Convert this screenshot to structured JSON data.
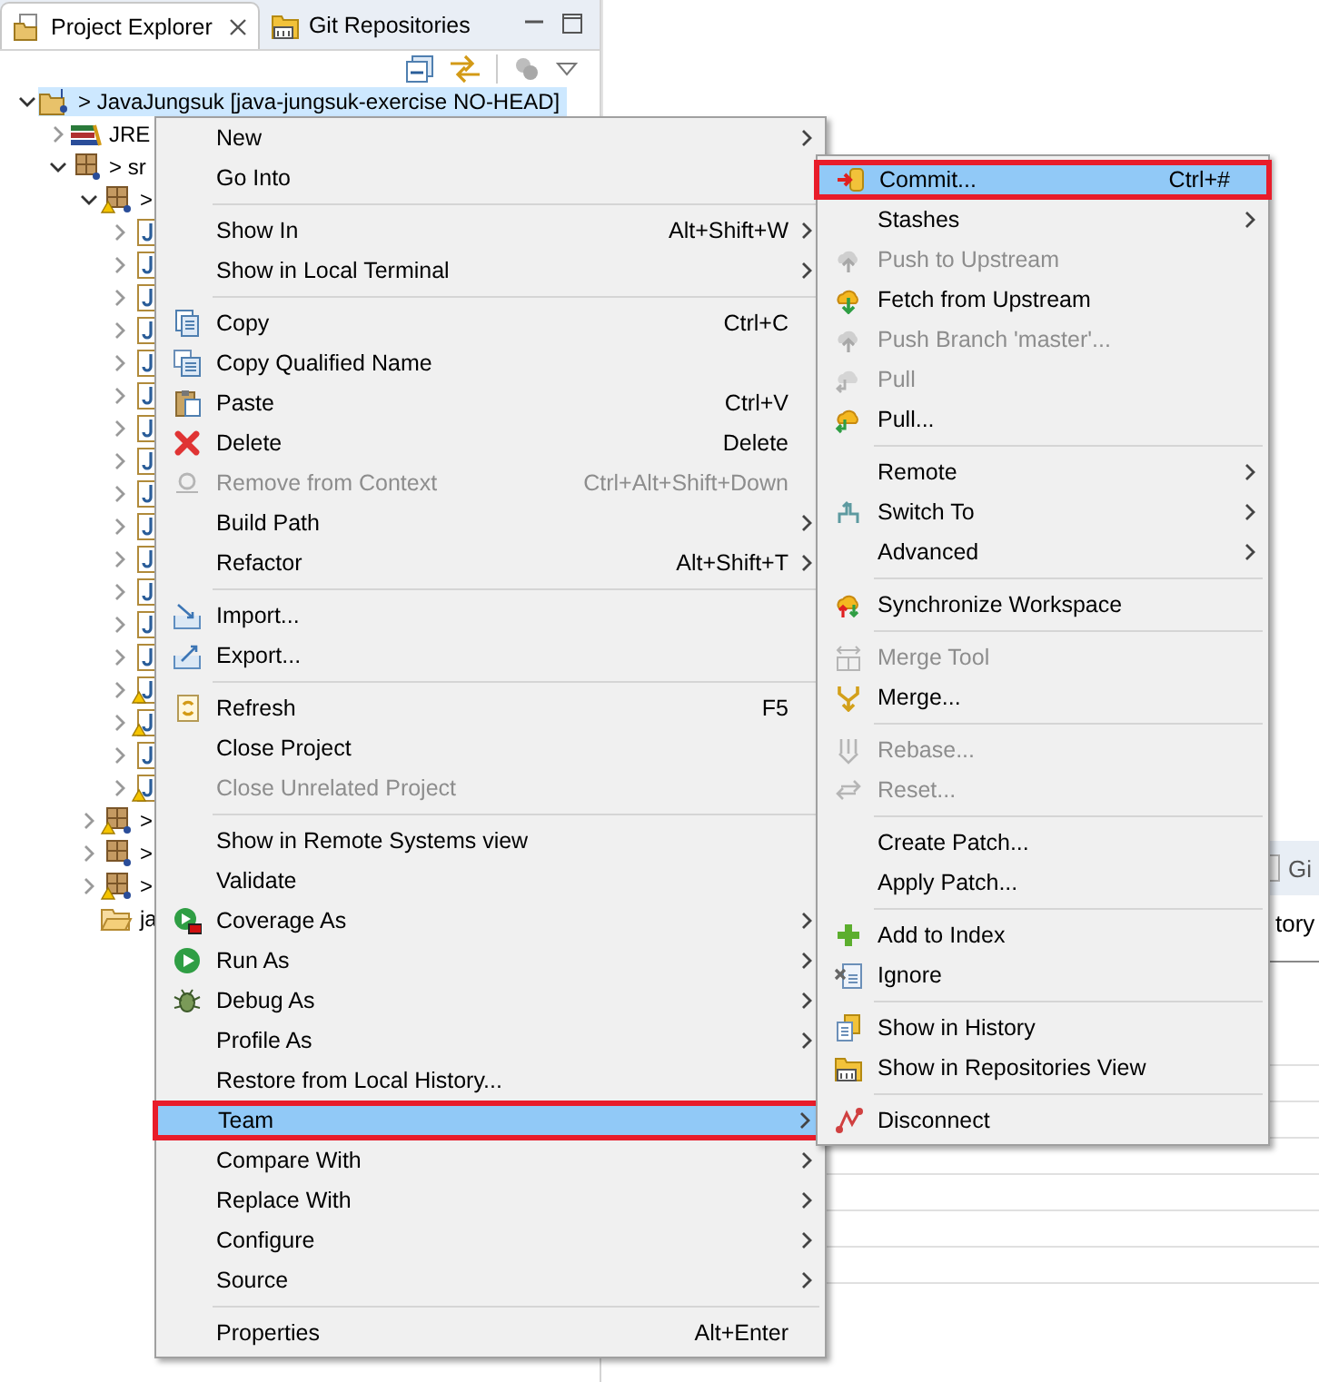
{
  "explorer": {
    "tabs": [
      {
        "label": "Project Explorer",
        "selected": true,
        "closable": true
      },
      {
        "label": "Git Repositories",
        "selected": false,
        "closable": false
      }
    ],
    "tree": [
      {
        "kind": "project",
        "label": "> JavaJungsuk [java-jungsuk-exercise NO-HEAD]",
        "selected": true,
        "expanded": true,
        "children": [
          {
            "kind": "library",
            "label": "JRE",
            "selected": false,
            "expanded": false
          },
          {
            "kind": "source",
            "label": "> sr",
            "selected": false,
            "expanded": true,
            "children": [
              {
                "kind": "package",
                "label": ">",
                "selected": false,
                "expanded": true,
                "warning": true,
                "children": [
                  {
                    "kind": "file",
                    "selected": false,
                    "expanded": false,
                    "warning": false
                  },
                  {
                    "kind": "file",
                    "selected": false,
                    "expanded": false,
                    "warning": false
                  },
                  {
                    "kind": "file",
                    "selected": false,
                    "expanded": false,
                    "warning": false
                  },
                  {
                    "kind": "file",
                    "selected": false,
                    "expanded": false,
                    "warning": false
                  },
                  {
                    "kind": "file",
                    "selected": false,
                    "expanded": false,
                    "warning": false
                  },
                  {
                    "kind": "file",
                    "selected": false,
                    "expanded": false,
                    "warning": false
                  },
                  {
                    "kind": "file",
                    "selected": false,
                    "expanded": false,
                    "warning": false
                  },
                  {
                    "kind": "file",
                    "selected": false,
                    "expanded": false,
                    "warning": false
                  },
                  {
                    "kind": "file",
                    "selected": false,
                    "expanded": false,
                    "warning": false
                  },
                  {
                    "kind": "file",
                    "selected": false,
                    "expanded": false,
                    "warning": false
                  },
                  {
                    "kind": "file",
                    "selected": false,
                    "expanded": false,
                    "warning": false
                  },
                  {
                    "kind": "file",
                    "selected": false,
                    "expanded": false,
                    "warning": false
                  },
                  {
                    "kind": "file",
                    "selected": false,
                    "expanded": false,
                    "warning": false
                  },
                  {
                    "kind": "file",
                    "selected": false,
                    "expanded": false,
                    "warning": false
                  },
                  {
                    "kind": "file",
                    "selected": false,
                    "expanded": false,
                    "warning": true
                  },
                  {
                    "kind": "file",
                    "selected": false,
                    "expanded": false,
                    "warning": true
                  },
                  {
                    "kind": "file",
                    "selected": false,
                    "expanded": false,
                    "warning": false
                  },
                  {
                    "kind": "file",
                    "selected": false,
                    "expanded": false,
                    "warning": true
                  }
                ]
              },
              {
                "kind": "package",
                "label": ">",
                "selected": false,
                "expanded": false,
                "warning": true
              },
              {
                "kind": "package",
                "label": ">",
                "selected": false,
                "expanded": false,
                "warning": false
              },
              {
                "kind": "package",
                "label": ">",
                "selected": false,
                "expanded": false,
                "warning": true
              },
              {
                "kind": "folder",
                "label": "ja",
                "selected": false
              }
            ]
          }
        ]
      }
    ]
  },
  "context_menu": {
    "items": [
      {
        "kind": "item",
        "label": "New",
        "submenu": true,
        "disabled": false,
        "selected": false,
        "icon": false
      },
      {
        "kind": "item",
        "label": "Go Into",
        "submenu": false,
        "disabled": false,
        "selected": false,
        "icon": false
      },
      {
        "kind": "separator"
      },
      {
        "kind": "item",
        "label": "Show In",
        "shortcut": "Alt+Shift+W",
        "submenu": true,
        "disabled": false,
        "selected": false,
        "icon": false
      },
      {
        "kind": "item",
        "label": "Show in Local Terminal",
        "submenu": true,
        "disabled": false,
        "selected": false,
        "icon": false
      },
      {
        "kind": "separator"
      },
      {
        "kind": "item",
        "label": "Copy",
        "shortcut": "Ctrl+C",
        "submenu": false,
        "disabled": false,
        "selected": false,
        "icon": true
      },
      {
        "kind": "item",
        "label": "Copy Qualified Name",
        "submenu": false,
        "disabled": false,
        "selected": false,
        "icon": true
      },
      {
        "kind": "item",
        "label": "Paste",
        "shortcut": "Ctrl+V",
        "submenu": false,
        "disabled": false,
        "selected": false,
        "icon": true
      },
      {
        "kind": "item",
        "label": "Delete",
        "shortcut": "Delete",
        "submenu": false,
        "disabled": false,
        "selected": false,
        "icon": true
      },
      {
        "kind": "item",
        "label": "Remove from Context",
        "shortcut": "Ctrl+Alt+Shift+Down",
        "submenu": false,
        "disabled": true,
        "selected": false,
        "icon": true
      },
      {
        "kind": "item",
        "label": "Build Path",
        "submenu": true,
        "disabled": false,
        "selected": false,
        "icon": false
      },
      {
        "kind": "item",
        "label": "Refactor",
        "shortcut": "Alt+Shift+T",
        "submenu": true,
        "disabled": false,
        "selected": false,
        "icon": false
      },
      {
        "kind": "separator"
      },
      {
        "kind": "item",
        "label": "Import...",
        "submenu": false,
        "disabled": false,
        "selected": false,
        "icon": true
      },
      {
        "kind": "item",
        "label": "Export...",
        "submenu": false,
        "disabled": false,
        "selected": false,
        "icon": true
      },
      {
        "kind": "separator"
      },
      {
        "kind": "item",
        "label": "Refresh",
        "shortcut": "F5",
        "submenu": false,
        "disabled": false,
        "selected": false,
        "icon": true
      },
      {
        "kind": "item",
        "label": "Close Project",
        "submenu": false,
        "disabled": false,
        "selected": false,
        "icon": false
      },
      {
        "kind": "item",
        "label": "Close Unrelated Project",
        "submenu": false,
        "disabled": true,
        "selected": false,
        "icon": false
      },
      {
        "kind": "separator"
      },
      {
        "kind": "item",
        "label": "Show in Remote Systems view",
        "submenu": false,
        "disabled": false,
        "selected": false,
        "icon": false
      },
      {
        "kind": "item",
        "label": "Validate",
        "submenu": false,
        "disabled": false,
        "selected": false,
        "icon": false
      },
      {
        "kind": "item",
        "label": "Coverage As",
        "submenu": true,
        "disabled": false,
        "selected": false,
        "icon": true
      },
      {
        "kind": "item",
        "label": "Run As",
        "submenu": true,
        "disabled": false,
        "selected": false,
        "icon": true
      },
      {
        "kind": "item",
        "label": "Debug As",
        "submenu": true,
        "disabled": false,
        "selected": false,
        "icon": true
      },
      {
        "kind": "item",
        "label": "Profile As",
        "submenu": true,
        "disabled": false,
        "selected": false,
        "icon": false
      },
      {
        "kind": "item",
        "label": "Restore from Local History...",
        "submenu": false,
        "disabled": false,
        "selected": false,
        "icon": false
      },
      {
        "kind": "item",
        "label": "Team",
        "submenu": true,
        "disabled": false,
        "selected": true,
        "icon": false
      },
      {
        "kind": "item",
        "label": "Compare With",
        "submenu": true,
        "disabled": false,
        "selected": false,
        "icon": false
      },
      {
        "kind": "item",
        "label": "Replace With",
        "submenu": true,
        "disabled": false,
        "selected": false,
        "icon": false
      },
      {
        "kind": "item",
        "label": "Configure",
        "submenu": true,
        "disabled": false,
        "selected": false,
        "icon": false
      },
      {
        "kind": "item",
        "label": "Source",
        "submenu": true,
        "disabled": false,
        "selected": false,
        "icon": false
      },
      {
        "kind": "separator"
      },
      {
        "kind": "item",
        "label": "Properties",
        "shortcut": "Alt+Enter",
        "submenu": false,
        "disabled": false,
        "selected": false,
        "icon": false
      }
    ]
  },
  "team_submenu": {
    "items": [
      {
        "kind": "item",
        "label": "Commit...",
        "shortcut": "Ctrl+#",
        "submenu": false,
        "disabled": false,
        "selected": true,
        "icon": true
      },
      {
        "kind": "item",
        "label": "Stashes",
        "submenu": true,
        "disabled": false,
        "selected": false,
        "icon": false
      },
      {
        "kind": "item",
        "label": "Push to Upstream",
        "submenu": false,
        "disabled": true,
        "selected": false,
        "icon": true
      },
      {
        "kind": "item",
        "label": "Fetch from Upstream",
        "submenu": false,
        "disabled": false,
        "selected": false,
        "icon": true
      },
      {
        "kind": "item",
        "label": "Push Branch 'master'...",
        "submenu": false,
        "disabled": true,
        "selected": false,
        "icon": true
      },
      {
        "kind": "item",
        "label": "Pull",
        "submenu": false,
        "disabled": true,
        "selected": false,
        "icon": true
      },
      {
        "kind": "item",
        "label": "Pull...",
        "submenu": false,
        "disabled": false,
        "selected": false,
        "icon": true
      },
      {
        "kind": "separator"
      },
      {
        "kind": "item",
        "label": "Remote",
        "submenu": true,
        "disabled": false,
        "selected": false,
        "icon": false
      },
      {
        "kind": "item",
        "label": "Switch To",
        "submenu": true,
        "disabled": false,
        "selected": false,
        "icon": true
      },
      {
        "kind": "item",
        "label": "Advanced",
        "submenu": true,
        "disabled": false,
        "selected": false,
        "icon": false
      },
      {
        "kind": "separator"
      },
      {
        "kind": "item",
        "label": "Synchronize Workspace",
        "submenu": false,
        "disabled": false,
        "selected": false,
        "icon": true
      },
      {
        "kind": "separator"
      },
      {
        "kind": "item",
        "label": "Merge Tool",
        "submenu": false,
        "disabled": true,
        "selected": false,
        "icon": true
      },
      {
        "kind": "item",
        "label": "Merge...",
        "submenu": false,
        "disabled": false,
        "selected": false,
        "icon": true
      },
      {
        "kind": "separator"
      },
      {
        "kind": "item",
        "label": "Rebase...",
        "submenu": false,
        "disabled": true,
        "selected": false,
        "icon": true
      },
      {
        "kind": "item",
        "label": "Reset...",
        "submenu": false,
        "disabled": true,
        "selected": false,
        "icon": true
      },
      {
        "kind": "separator"
      },
      {
        "kind": "item",
        "label": "Create Patch...",
        "submenu": false,
        "disabled": false,
        "selected": false,
        "icon": false
      },
      {
        "kind": "item",
        "label": "Apply Patch...",
        "submenu": false,
        "disabled": false,
        "selected": false,
        "icon": false
      },
      {
        "kind": "separator"
      },
      {
        "kind": "item",
        "label": "Add to Index",
        "submenu": false,
        "disabled": false,
        "selected": false,
        "icon": true
      },
      {
        "kind": "item",
        "label": "Ignore",
        "submenu": false,
        "disabled": false,
        "selected": false,
        "icon": true
      },
      {
        "kind": "separator"
      },
      {
        "kind": "item",
        "label": "Show in History",
        "submenu": false,
        "disabled": false,
        "selected": false,
        "icon": true
      },
      {
        "kind": "item",
        "label": "Show in Repositories View",
        "submenu": false,
        "disabled": false,
        "selected": false,
        "icon": true
      },
      {
        "kind": "separator"
      },
      {
        "kind": "item",
        "label": "Disconnect",
        "submenu": false,
        "disabled": false,
        "selected": false,
        "icon": true
      }
    ]
  },
  "bottom_panel": {
    "tab": "Gi",
    "text": "tory"
  }
}
